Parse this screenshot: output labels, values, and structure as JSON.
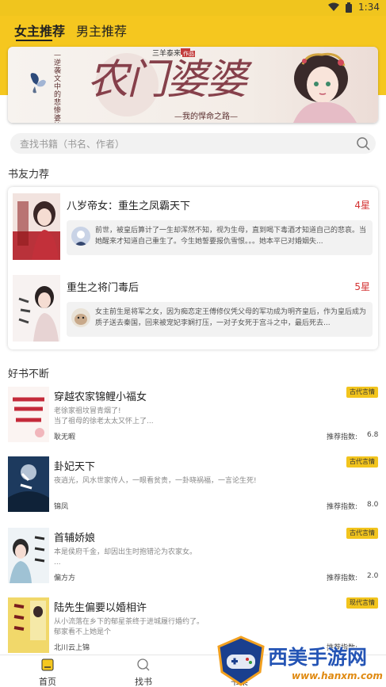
{
  "status_bar": {
    "time": "1:34"
  },
  "tabs": [
    {
      "label": "女主推荐",
      "active": true
    },
    {
      "label": "男主推荐",
      "active": false
    }
  ],
  "banner": {
    "title": "农门婆婆",
    "subtitle": "—逆袭文中的悲惨婆婆",
    "author_line": "三羊泰来",
    "author_tag": "作品",
    "tagline": "—我的悍命之路—"
  },
  "search": {
    "placeholder": "查找书籍（书名、作者）"
  },
  "section_recommend": {
    "title": "书友力荐"
  },
  "recommendations": [
    {
      "title": "八岁帝女：重生之凤霸天下",
      "rating": "4星",
      "comment": "前世，被皇后算计了一生却浑然不知，视为生母，直到喝下毒酒才知道自己的悲哀。当她醒来才知道自己重生了。今生她誓要报仇雪恨。。。她本平已对婚姻失..."
    },
    {
      "title": "重生之将门毒后",
      "rating": "5星",
      "comment": "女主前生是将军之女，因为痴恋定王傅修仪凭父母的军功成为明齐皇后，作为皇后成为质子送去秦国，回来被宠妃李娴打压，一对子女死于宫斗之中，最后死去..."
    }
  ],
  "section_books": {
    "title": "好书不断"
  },
  "books": [
    {
      "title": "穿越农家锦鲤小福女",
      "tag": "古代言情",
      "desc_line1": "老徐家祖坟冒青烟了!",
      "desc_line2": "当了祖母的徐老太太又怀上了...",
      "author": "耿无暇",
      "score_label": "推荐指数:",
      "score": "6.8"
    },
    {
      "title": "卦妃天下",
      "tag": "古代言情",
      "desc_line1": "夜逍光，风水世家传人，一眼看贫贵，一卦晓祸福，一言论生死!",
      "desc_line2": "",
      "author": "锦凤",
      "score_label": "推荐指数:",
      "score": "8.0"
    },
    {
      "title": "首辅娇娘",
      "tag": "古代言情",
      "desc_line1": "本是侯府千金，却因出生时抱错沦为农家女。",
      "desc_line2": "...",
      "author": "偏方方",
      "score_label": "推荐指数:",
      "score": "2.0"
    },
    {
      "title": "陆先生偏要以婚相许",
      "tag": "现代言情",
      "desc_line1": "从小流落在乡下的郁星茶终于进城履行婚约了。",
      "desc_line2": "郁家看不上她是个",
      "author": "北川云上锦",
      "score_label": "推荐指数:",
      "score": ""
    }
  ],
  "bottom_nav": [
    {
      "label": "首页",
      "icon": "home-icon",
      "active": true
    },
    {
      "label": "找书",
      "icon": "search-icon",
      "active": false
    },
    {
      "label": "书架",
      "icon": "bookshelf-icon",
      "active": false
    }
  ],
  "watermark": {
    "title": "西美手游网",
    "url": "www.hanxm.com"
  },
  "colors": {
    "accent": "#f5c71f",
    "rating": "#d43333",
    "tag": "#f2c41d"
  }
}
